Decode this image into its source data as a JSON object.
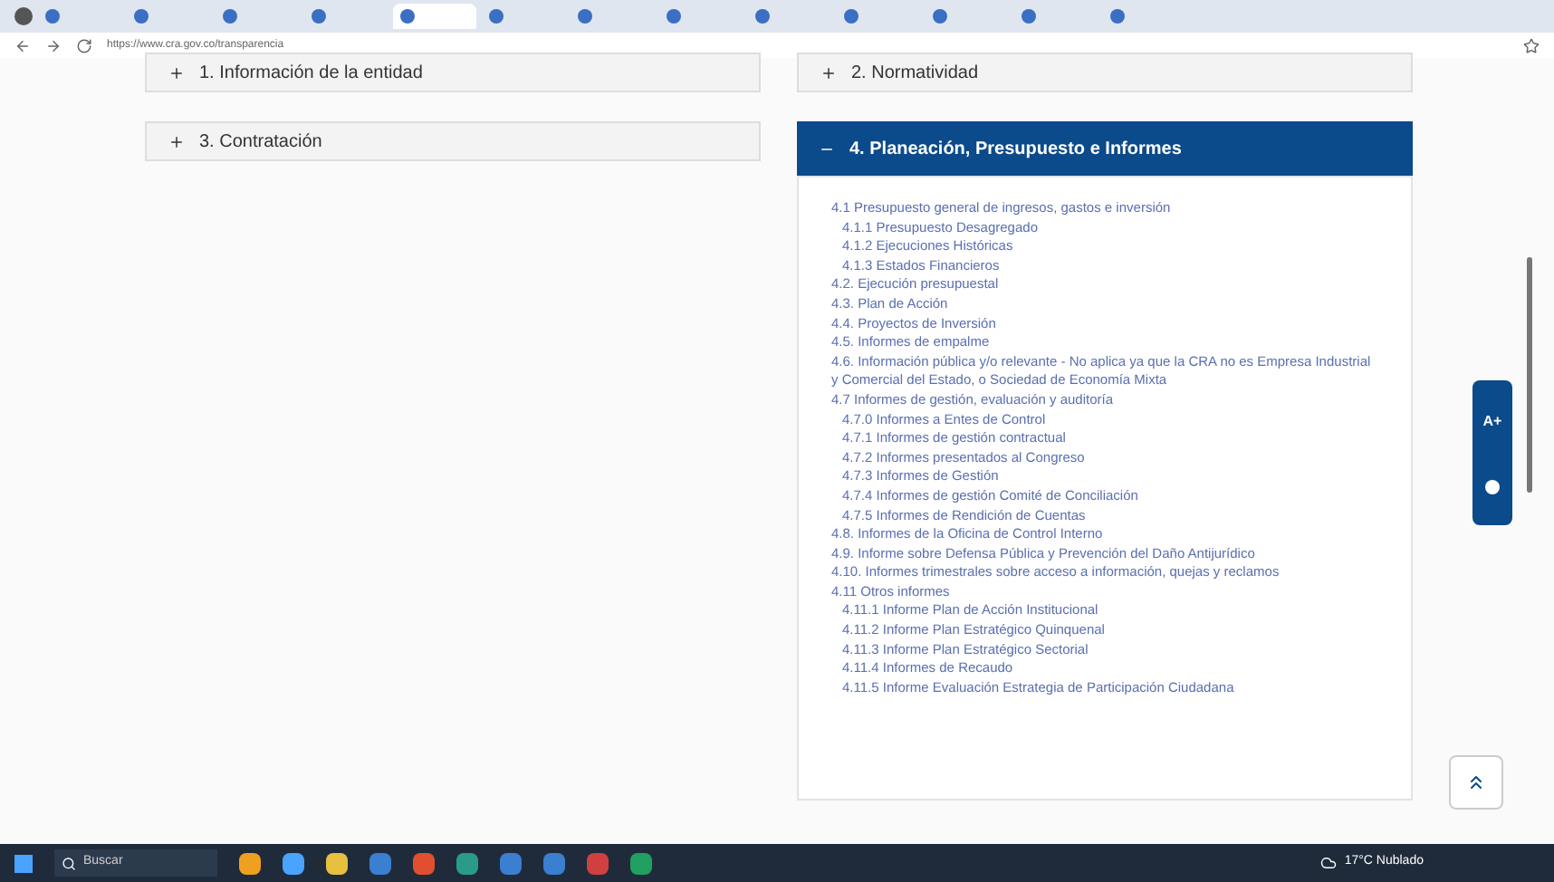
{
  "browser": {
    "tabs": [
      {
        "selected": false
      },
      {
        "selected": false
      },
      {
        "selected": false
      },
      {
        "selected": false
      },
      {
        "selected": true
      },
      {
        "selected": false
      },
      {
        "selected": false
      },
      {
        "selected": false
      },
      {
        "selected": false
      },
      {
        "selected": false
      },
      {
        "selected": false
      },
      {
        "selected": false
      },
      {
        "selected": false
      }
    ],
    "address": "https://www.cra.gov.co/transparencia"
  },
  "sections": [
    {
      "title": "1. Información de la entidad",
      "expanded": false
    },
    {
      "title": "2. Normatividad",
      "expanded": false
    },
    {
      "title": "3. Contratación",
      "expanded": false
    },
    {
      "title": "4. Planeación, Presupuesto e Informes",
      "expanded": true,
      "links": [
        {
          "label": "4.1 Presupuesto general de ingresos, gastos e inversión",
          "children": [
            {
              "label": "4.1.1 Presupuesto Desagregado"
            },
            {
              "label": "4.1.2 Ejecuciones Históricas"
            },
            {
              "label": "4.1.3 Estados Financieros"
            }
          ]
        },
        {
          "label": "4.2. Ejecución presupuestal"
        },
        {
          "label": "4.3. Plan de Acción"
        },
        {
          "label": "4.4. Proyectos de Inversión"
        },
        {
          "label": "4.5. Informes de empalme"
        },
        {
          "label": "4.6. Información pública y/o relevante - No aplica ya que la CRA no es Empresa Industrial y Comercial del Estado, o Sociedad de Economía Mixta"
        },
        {
          "label": "4.7 Informes de gestión, evaluación y auditoría",
          "children": [
            {
              "label": "4.7.0 Informes a Entes de Control"
            },
            {
              "label": "4.7.1 Informes de gestión contractual"
            },
            {
              "label": "4.7.2 Informes presentados al Congreso"
            },
            {
              "label": "4.7.3 Informes de Gestión"
            },
            {
              "label": "4.7.4 Informes de gestión Comité de Conciliación"
            },
            {
              "label": "4.7.5 Informes de Rendición de Cuentas"
            }
          ]
        },
        {
          "label": "4.8. Informes de la Oficina de Control Interno"
        },
        {
          "label": "4.9. Informe sobre Defensa Pública y Prevención del Daño Antijurídico"
        },
        {
          "label": "4.10. Informes trimestrales sobre acceso a información, quejas y reclamos"
        },
        {
          "label": "4.11 Otros informes",
          "children": [
            {
              "label": "4.11.1 Informe Plan de Acción Institucional"
            },
            {
              "label": "4.11.2 Informe Plan Estratégico Quinquenal"
            },
            {
              "label": "4.11.3 Informe Plan Estratégico Sectorial"
            },
            {
              "label": "4.11.4 Informes de Recaudo"
            },
            {
              "label": "4.11.5 Informe Evaluación Estrategia de Participación Ciudadana"
            }
          ]
        }
      ]
    }
  ],
  "accessibility": {
    "font_label": "A+"
  },
  "taskbar": {
    "search_placeholder": "Buscar",
    "weather": "17°C Nublado"
  }
}
